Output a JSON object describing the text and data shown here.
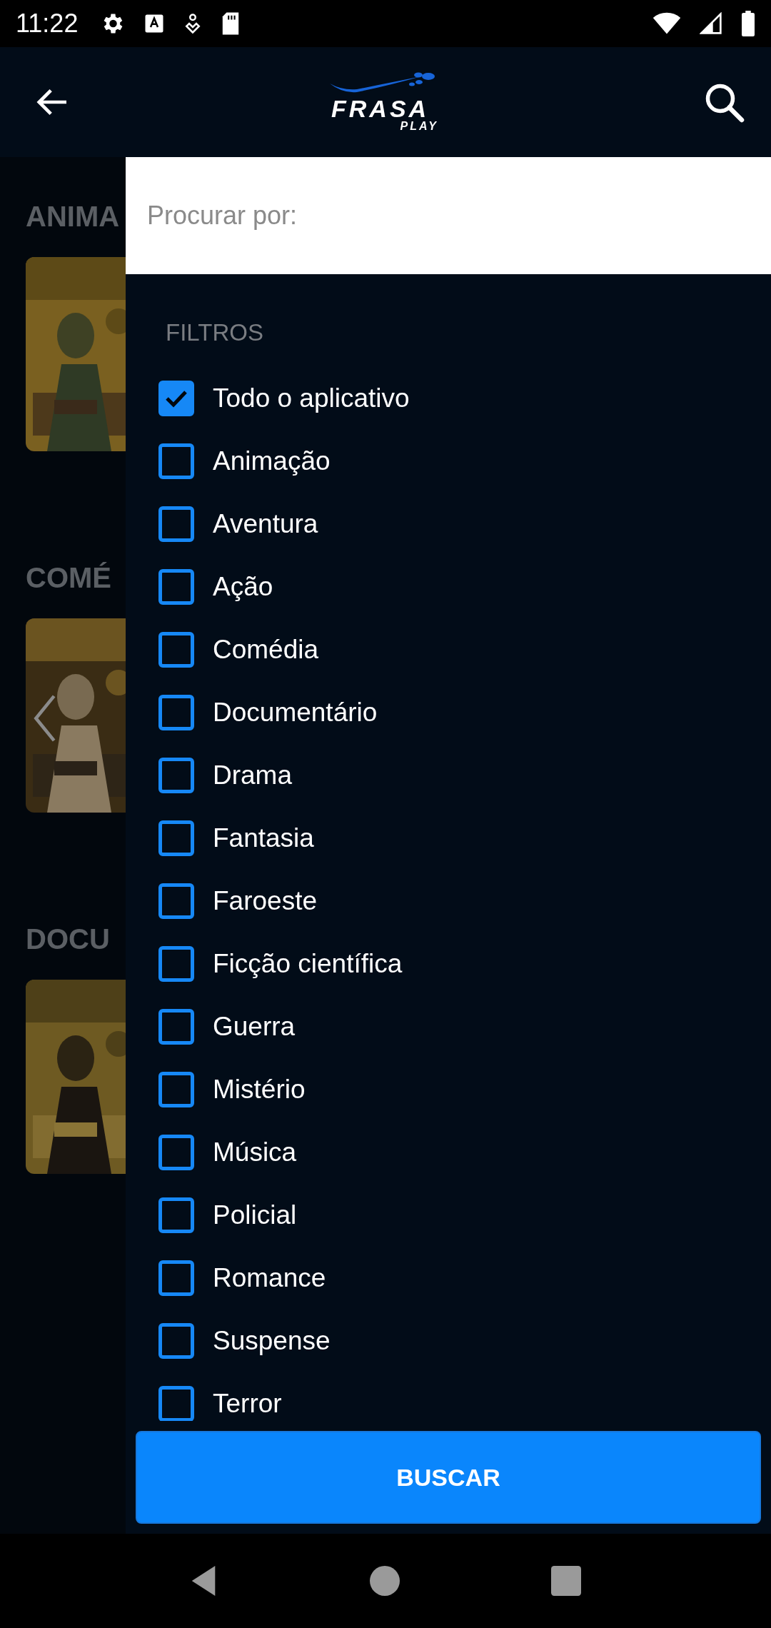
{
  "status_bar": {
    "time": "11:22"
  },
  "app_bar": {
    "logo": {
      "wordmark": "FRASA",
      "tagline": "PLAY"
    }
  },
  "background_sections": [
    {
      "title": "ANIMA",
      "has_prev_arrow": false
    },
    {
      "title": "COMÉ",
      "has_prev_arrow": true
    },
    {
      "title": "DOCU",
      "has_prev_arrow": false
    }
  ],
  "search": {
    "placeholder": "Procurar por:"
  },
  "filters": {
    "heading": "FILTROS",
    "items": [
      {
        "label": "Todo o aplicativo",
        "checked": true
      },
      {
        "label": "Animação",
        "checked": false
      },
      {
        "label": "Aventura",
        "checked": false
      },
      {
        "label": "Ação",
        "checked": false
      },
      {
        "label": "Comédia",
        "checked": false
      },
      {
        "label": "Documentário",
        "checked": false
      },
      {
        "label": "Drama",
        "checked": false
      },
      {
        "label": "Fantasia",
        "checked": false
      },
      {
        "label": "Faroeste",
        "checked": false
      },
      {
        "label": "Ficção científica",
        "checked": false
      },
      {
        "label": "Guerra",
        "checked": false
      },
      {
        "label": "Mistério",
        "checked": false
      },
      {
        "label": "Música",
        "checked": false
      },
      {
        "label": "Policial",
        "checked": false
      },
      {
        "label": "Romance",
        "checked": false
      },
      {
        "label": "Suspense",
        "checked": false
      },
      {
        "label": "Terror",
        "checked": false
      }
    ]
  },
  "submit_button": "BUSCAR"
}
